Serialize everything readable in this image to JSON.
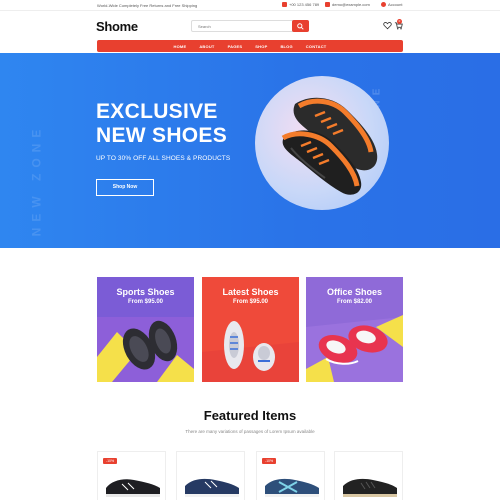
{
  "topbar": {
    "promo": "World-Wide Completely Free Returns and Free Shipping",
    "phone": "+00 123 456 789",
    "email": "demo@example.com",
    "account": "Account"
  },
  "header": {
    "logo": "Shome",
    "search_placeholder": "Search",
    "cart_count": "0"
  },
  "nav": {
    "items": [
      "HOME",
      "ABOUT",
      "PAGES",
      "SHOP",
      "BLOG",
      "CONTACT"
    ]
  },
  "hero": {
    "title_line1": "EXCLUSIVE",
    "title_line2": "NEW SHOES",
    "subtitle": "UP TO 30% OFF ALL SHOES & PRODUCTS",
    "button": "Shop Now",
    "watermark": "NEW ZONE",
    "watermark2": "NEW ZONE"
  },
  "categories": [
    {
      "title": "Sports Shoes",
      "price": "From $95.00",
      "bg": "#7b5cd6"
    },
    {
      "title": "Latest Shoes",
      "price": "From $95.00",
      "bg": "#ef4a3a"
    },
    {
      "title": "Office Shoes",
      "price": "From $82.00",
      "bg": "#8f6ad8"
    }
  ],
  "featured": {
    "title": "Featured Items",
    "subtitle": "There are many variations of passages of Lorem Ipsum available",
    "products": [
      {
        "badge": "-10%"
      },
      {
        "badge": ""
      },
      {
        "badge": "-10%"
      },
      {
        "badge": ""
      }
    ]
  },
  "colors": {
    "accent": "#e8402f",
    "hero_blue": "#2a73e8"
  }
}
